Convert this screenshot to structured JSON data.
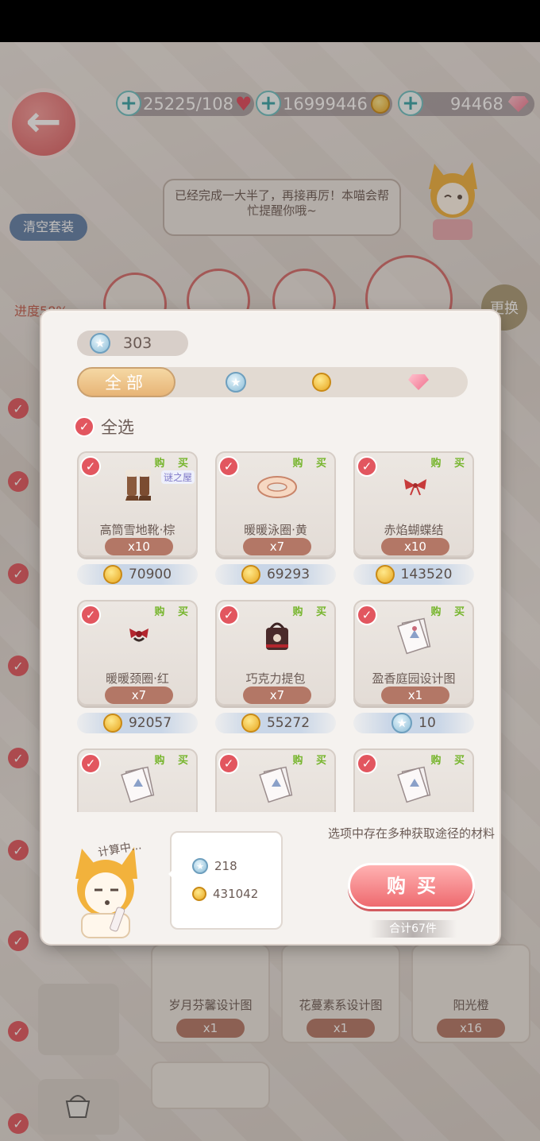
{
  "resources": {
    "stamina": "25225/108",
    "coins": "16999446",
    "gems": "94468"
  },
  "speech": "已经完成一大半了，再接再厉！本喵会帮忙提醒你哦~",
  "clear_outfit_label": "清空套装",
  "progress_label": "进度58%",
  "swap_label": "更换",
  "background_cards": [
    {
      "name": "岁月芬馨设计图",
      "qty": "x1"
    },
    {
      "name": "花蔓素系设计图",
      "qty": "x1"
    },
    {
      "name": "阳光橙",
      "qty": "x16"
    }
  ],
  "modal": {
    "star_count": "303",
    "tabs": {
      "all": "全部"
    },
    "select_all": "全选",
    "buy_tag": "购 买",
    "mystery_tag": "谜之屋",
    "items": [
      {
        "name": "高筒雪地靴·棕",
        "qty": "x10",
        "price": "70900",
        "currency": "coin",
        "icon": "boots-icon"
      },
      {
        "name": "暖暖泳圈·黄",
        "qty": "x7",
        "price": "69293",
        "currency": "coin",
        "icon": "swim-ring-icon"
      },
      {
        "name": "赤焰蝴蝶结",
        "qty": "x10",
        "price": "143520",
        "currency": "coin",
        "icon": "bow-icon"
      },
      {
        "name": "暖暖颈圈·红",
        "qty": "x7",
        "price": "92057",
        "currency": "coin",
        "icon": "collar-icon"
      },
      {
        "name": "巧克力提包",
        "qty": "x7",
        "price": "55272",
        "currency": "coin",
        "icon": "handbag-icon"
      },
      {
        "name": "盈香庭园设计图",
        "qty": "x1",
        "price": "10",
        "currency": "star",
        "icon": "blueprint-icon"
      }
    ],
    "calculating": "计算中...",
    "calc_stars": "218",
    "calc_coins": "431042",
    "note": "选项中存在多种获取途径的材料",
    "buy_label": "购买",
    "total": "合计67件"
  }
}
